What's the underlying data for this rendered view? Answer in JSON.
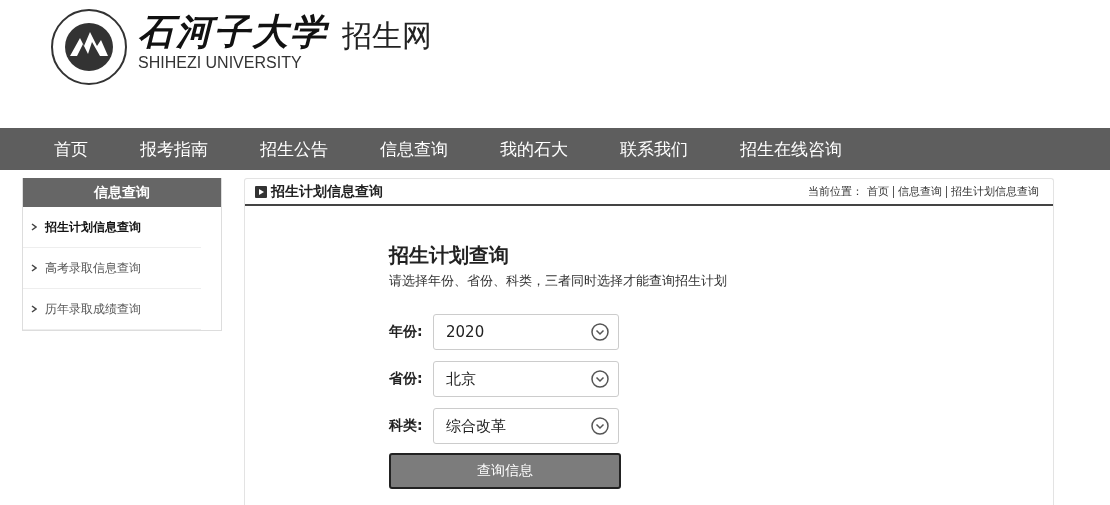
{
  "header": {
    "university_name": "石河子大学",
    "university_name_en": "SHIHEZI UNIVERSITY",
    "site_name": "招生网"
  },
  "nav": {
    "items": [
      {
        "label": "首页"
      },
      {
        "label": "报考指南"
      },
      {
        "label": "招生公告"
      },
      {
        "label": "信息查询"
      },
      {
        "label": "我的石大"
      },
      {
        "label": "联系我们"
      },
      {
        "label": "招生在线咨询"
      }
    ]
  },
  "sidebar": {
    "title": "信息查询",
    "items": [
      {
        "label": "招生计划信息查询",
        "selected": true
      },
      {
        "label": "高考录取信息查询",
        "selected": false
      },
      {
        "label": "历年录取成绩查询",
        "selected": false
      }
    ]
  },
  "main": {
    "title": "招生计划信息查询",
    "breadcrumb": {
      "prefix": "当前位置：",
      "items": [
        "首页",
        "信息查询",
        "招生计划信息查询"
      ]
    },
    "form": {
      "heading": "招生计划查询",
      "instruction": "请选择年份、省份、科类，三者同时选择才能查询招生计划",
      "fields": [
        {
          "label": "年份:",
          "value": "2020"
        },
        {
          "label": "省份:",
          "value": "北京"
        },
        {
          "label": "科类:",
          "value": "综合改革"
        }
      ],
      "submit": "查询信息"
    }
  }
}
